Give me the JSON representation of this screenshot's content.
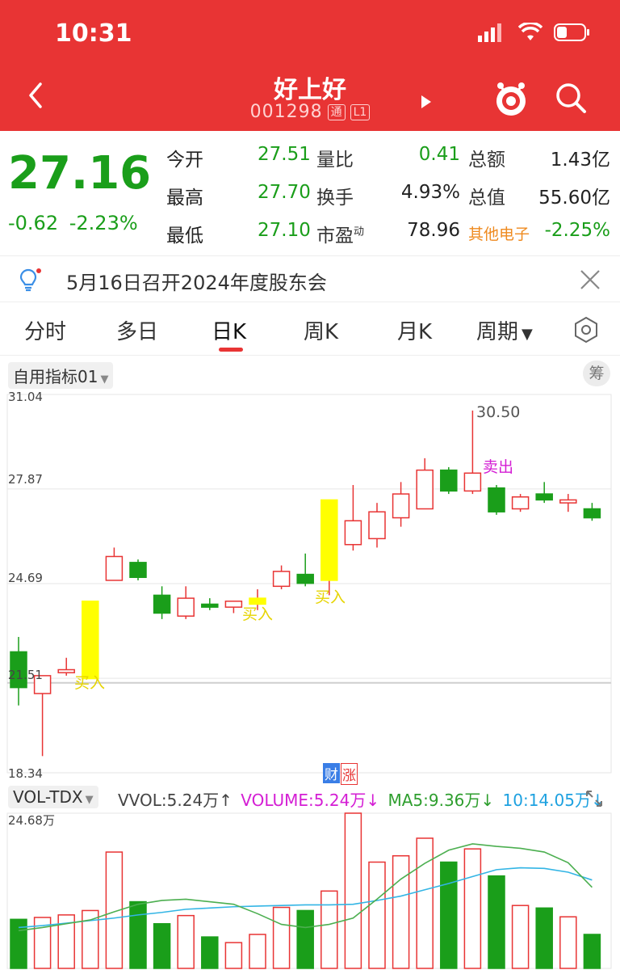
{
  "status": {
    "time": "10:31"
  },
  "header": {
    "title": "好上好",
    "code": "001298",
    "tag1": "通",
    "tag2": "L1"
  },
  "quote": {
    "price": "27.16",
    "change": "-0.62",
    "change_pct": "-2.23%",
    "rows": [
      {
        "l1": "今开",
        "v1": "27.51",
        "l2": "量比",
        "v2": "0.41",
        "l3": "总额",
        "v3": "1.43亿"
      },
      {
        "l1": "最高",
        "v1": "27.70",
        "l2": "换手",
        "v2": "4.93%",
        "l3": "总值",
        "v3": "55.60亿"
      },
      {
        "l1": "最低",
        "v1": "27.10",
        "l2": "市盈",
        "l2sup": "动",
        "v2": "78.96",
        "l3": "其他电子",
        "v3": "-2.25%"
      }
    ]
  },
  "notice": {
    "text": "5月16日召开2024年度股东会"
  },
  "tabs": [
    "分时",
    "多日",
    "日K",
    "周K",
    "月K",
    "周期"
  ],
  "indicator": {
    "selector": "自用指标01",
    "chip": "筹"
  },
  "price_axis": {
    "top": "31.04",
    "l2": "27.87",
    "l3": "24.69",
    "l4": "21.51",
    "bottom": "18.34"
  },
  "annotations": {
    "high": "30.50",
    "sell": "卖出",
    "buy": "买入",
    "cai": "财",
    "zhang": "涨"
  },
  "volume": {
    "selector": "VOL-TDX",
    "vvol_label": "VVOL:",
    "vvol_value": "5.24万↑",
    "volume_label": "VOLUME:",
    "volume_value": "5.24万↓",
    "ma5_label": "MA5:",
    "ma5_value": "9.36万↓",
    "ma10_label": "10:",
    "ma10_value": "14.05万↓",
    "axis_top": "24.68万"
  },
  "colors": {
    "up": "#e83434",
    "down": "#1a9e1a",
    "signal": "#ffff00",
    "ma5": "#4caf50",
    "ma10": "#33b5e5"
  },
  "chart_data": {
    "type": "candlestick",
    "ylim": [
      18.34,
      31.04
    ],
    "candles": [
      {
        "o": 22.4,
        "c": 21.2,
        "h": 22.9,
        "l": 20.6,
        "dir": "down"
      },
      {
        "o": 21.0,
        "c": 21.6,
        "h": 21.6,
        "l": 18.9,
        "dir": "up"
      },
      {
        "o": 21.7,
        "c": 21.8,
        "h": 22.2,
        "l": 21.6,
        "dir": "up"
      },
      {
        "o": 21.5,
        "c": 24.1,
        "h": 24.1,
        "l": 21.5,
        "dir": "signal"
      },
      {
        "o": 24.8,
        "c": 25.6,
        "h": 25.9,
        "l": 24.8,
        "dir": "up"
      },
      {
        "o": 25.4,
        "c": 24.9,
        "h": 25.5,
        "l": 24.8,
        "dir": "down"
      },
      {
        "o": 24.3,
        "c": 23.7,
        "h": 24.6,
        "l": 23.5,
        "dir": "down"
      },
      {
        "o": 23.6,
        "c": 24.2,
        "h": 24.6,
        "l": 23.5,
        "dir": "up"
      },
      {
        "o": 24.0,
        "c": 23.9,
        "h": 24.2,
        "l": 23.8,
        "dir": "down"
      },
      {
        "o": 23.9,
        "c": 24.1,
        "h": 24.1,
        "l": 23.7,
        "dir": "up"
      },
      {
        "o": 24.0,
        "c": 24.2,
        "h": 24.5,
        "l": 23.8,
        "dir": "signal"
      },
      {
        "o": 24.6,
        "c": 25.1,
        "h": 25.3,
        "l": 24.5,
        "dir": "up"
      },
      {
        "o": 25.0,
        "c": 24.7,
        "h": 25.7,
        "l": 24.6,
        "dir": "down"
      },
      {
        "o": 24.8,
        "c": 27.5,
        "h": 27.5,
        "l": 24.3,
        "dir": "signal"
      },
      {
        "o": 26.0,
        "c": 26.8,
        "h": 28.0,
        "l": 25.8,
        "dir": "up"
      },
      {
        "o": 26.2,
        "c": 27.1,
        "h": 27.4,
        "l": 25.9,
        "dir": "up"
      },
      {
        "o": 26.9,
        "c": 27.7,
        "h": 28.1,
        "l": 26.6,
        "dir": "up"
      },
      {
        "o": 27.2,
        "c": 28.5,
        "h": 28.9,
        "l": 27.2,
        "dir": "up"
      },
      {
        "o": 28.5,
        "c": 27.8,
        "h": 28.6,
        "l": 27.7,
        "dir": "down"
      },
      {
        "o": 27.8,
        "c": 28.4,
        "h": 30.5,
        "l": 27.7,
        "dir": "up"
      },
      {
        "o": 27.9,
        "c": 27.1,
        "h": 28.0,
        "l": 27.0,
        "dir": "down"
      },
      {
        "o": 27.2,
        "c": 27.6,
        "h": 27.7,
        "l": 27.1,
        "dir": "up"
      },
      {
        "o": 27.7,
        "c": 27.5,
        "h": 28.1,
        "l": 27.4,
        "dir": "down"
      },
      {
        "o": 27.5,
        "c": 27.4,
        "h": 27.7,
        "l": 27.1,
        "dir": "up"
      },
      {
        "o": 27.2,
        "c": 26.9,
        "h": 27.4,
        "l": 26.8,
        "dir": "down"
      }
    ],
    "volume_max": 24.68,
    "volumes": [
      {
        "v": 7.8,
        "dir": "down"
      },
      {
        "v": 8.1,
        "dir": "up"
      },
      {
        "v": 8.5,
        "dir": "up"
      },
      {
        "v": 9.2,
        "dir": "up"
      },
      {
        "v": 18.5,
        "dir": "up"
      },
      {
        "v": 10.6,
        "dir": "down"
      },
      {
        "v": 7.1,
        "dir": "down"
      },
      {
        "v": 8.4,
        "dir": "up"
      },
      {
        "v": 5.0,
        "dir": "down"
      },
      {
        "v": 4.1,
        "dir": "up"
      },
      {
        "v": 5.4,
        "dir": "up"
      },
      {
        "v": 9.7,
        "dir": "up"
      },
      {
        "v": 9.2,
        "dir": "down"
      },
      {
        "v": 12.3,
        "dir": "up"
      },
      {
        "v": 24.68,
        "dir": "up"
      },
      {
        "v": 16.9,
        "dir": "up"
      },
      {
        "v": 17.9,
        "dir": "up"
      },
      {
        "v": 20.7,
        "dir": "up"
      },
      {
        "v": 16.9,
        "dir": "down"
      },
      {
        "v": 19.0,
        "dir": "up"
      },
      {
        "v": 14.7,
        "dir": "down"
      },
      {
        "v": 10.0,
        "dir": "up"
      },
      {
        "v": 9.6,
        "dir": "down"
      },
      {
        "v": 8.2,
        "dir": "up"
      },
      {
        "v": 5.4,
        "dir": "down"
      }
    ],
    "ma5": [
      6.0,
      6.5,
      7.1,
      7.7,
      9.0,
      10.2,
      10.8,
      11.0,
      10.6,
      10.2,
      8.7,
      7.0,
      6.5,
      7.0,
      8.0,
      11.0,
      14.2,
      16.7,
      18.8,
      19.8,
      19.4,
      19.1,
      18.5,
      16.8,
      12.9
    ],
    "ma10": [
      6.5,
      6.8,
      7.2,
      7.6,
      8.0,
      8.5,
      8.9,
      9.4,
      9.6,
      9.8,
      9.9,
      10.0,
      10.1,
      10.1,
      10.2,
      10.8,
      11.5,
      12.5,
      13.5,
      14.6,
      15.7,
      16.0,
      15.9,
      15.3,
      14.05
    ]
  }
}
